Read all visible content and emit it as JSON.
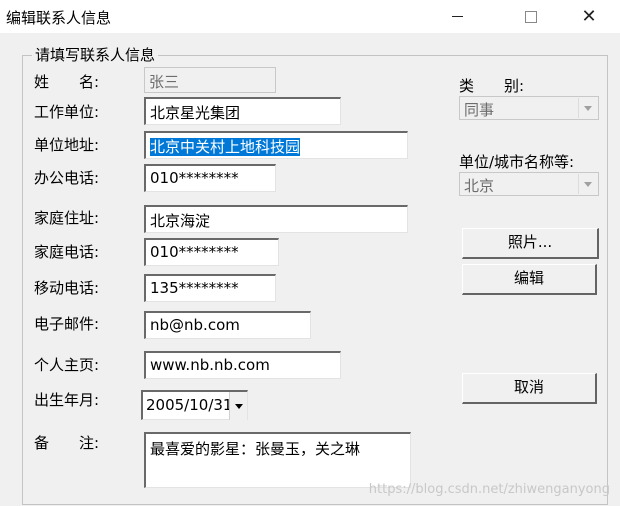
{
  "window": {
    "title": "编辑联系人信息",
    "minimize_icon": "minimize-icon",
    "maximize_icon": "maximize-icon",
    "close_icon": "close-icon"
  },
  "group": {
    "legend": "请填写联系人信息"
  },
  "form": {
    "name": {
      "label": "姓　　名:",
      "value": "张三"
    },
    "company": {
      "label": "工作单位:",
      "value": "北京星光集团"
    },
    "company_address": {
      "label": "单位地址:",
      "value": "北京中关村上地科技园"
    },
    "office_phone": {
      "label": "办公电话:",
      "value": "010********"
    },
    "home_address": {
      "label": "家庭住址:",
      "value": "北京海淀"
    },
    "home_phone": {
      "label": "家庭电话:",
      "value": "010********"
    },
    "mobile": {
      "label": "移动电话:",
      "value": "135********"
    },
    "email": {
      "label": "电子邮件:",
      "value": "nb@nb.com"
    },
    "homepage": {
      "label": "个人主页:",
      "value": "www.nb.nb.com"
    },
    "birth": {
      "label": "出生年月:",
      "value": "2005/10/31"
    },
    "notes": {
      "label": "备　　注:",
      "value": "最喜爱的影星：张曼玉，关之琳"
    },
    "category": {
      "label": "类　　别:",
      "value": "同事"
    },
    "org_city": {
      "label": "单位/城市名称等:",
      "value": "北京"
    }
  },
  "buttons": {
    "photo": "照片...",
    "edit": "编辑",
    "cancel": "取消"
  },
  "watermark": "https://blog.csdn.net/zhiwenganyong"
}
